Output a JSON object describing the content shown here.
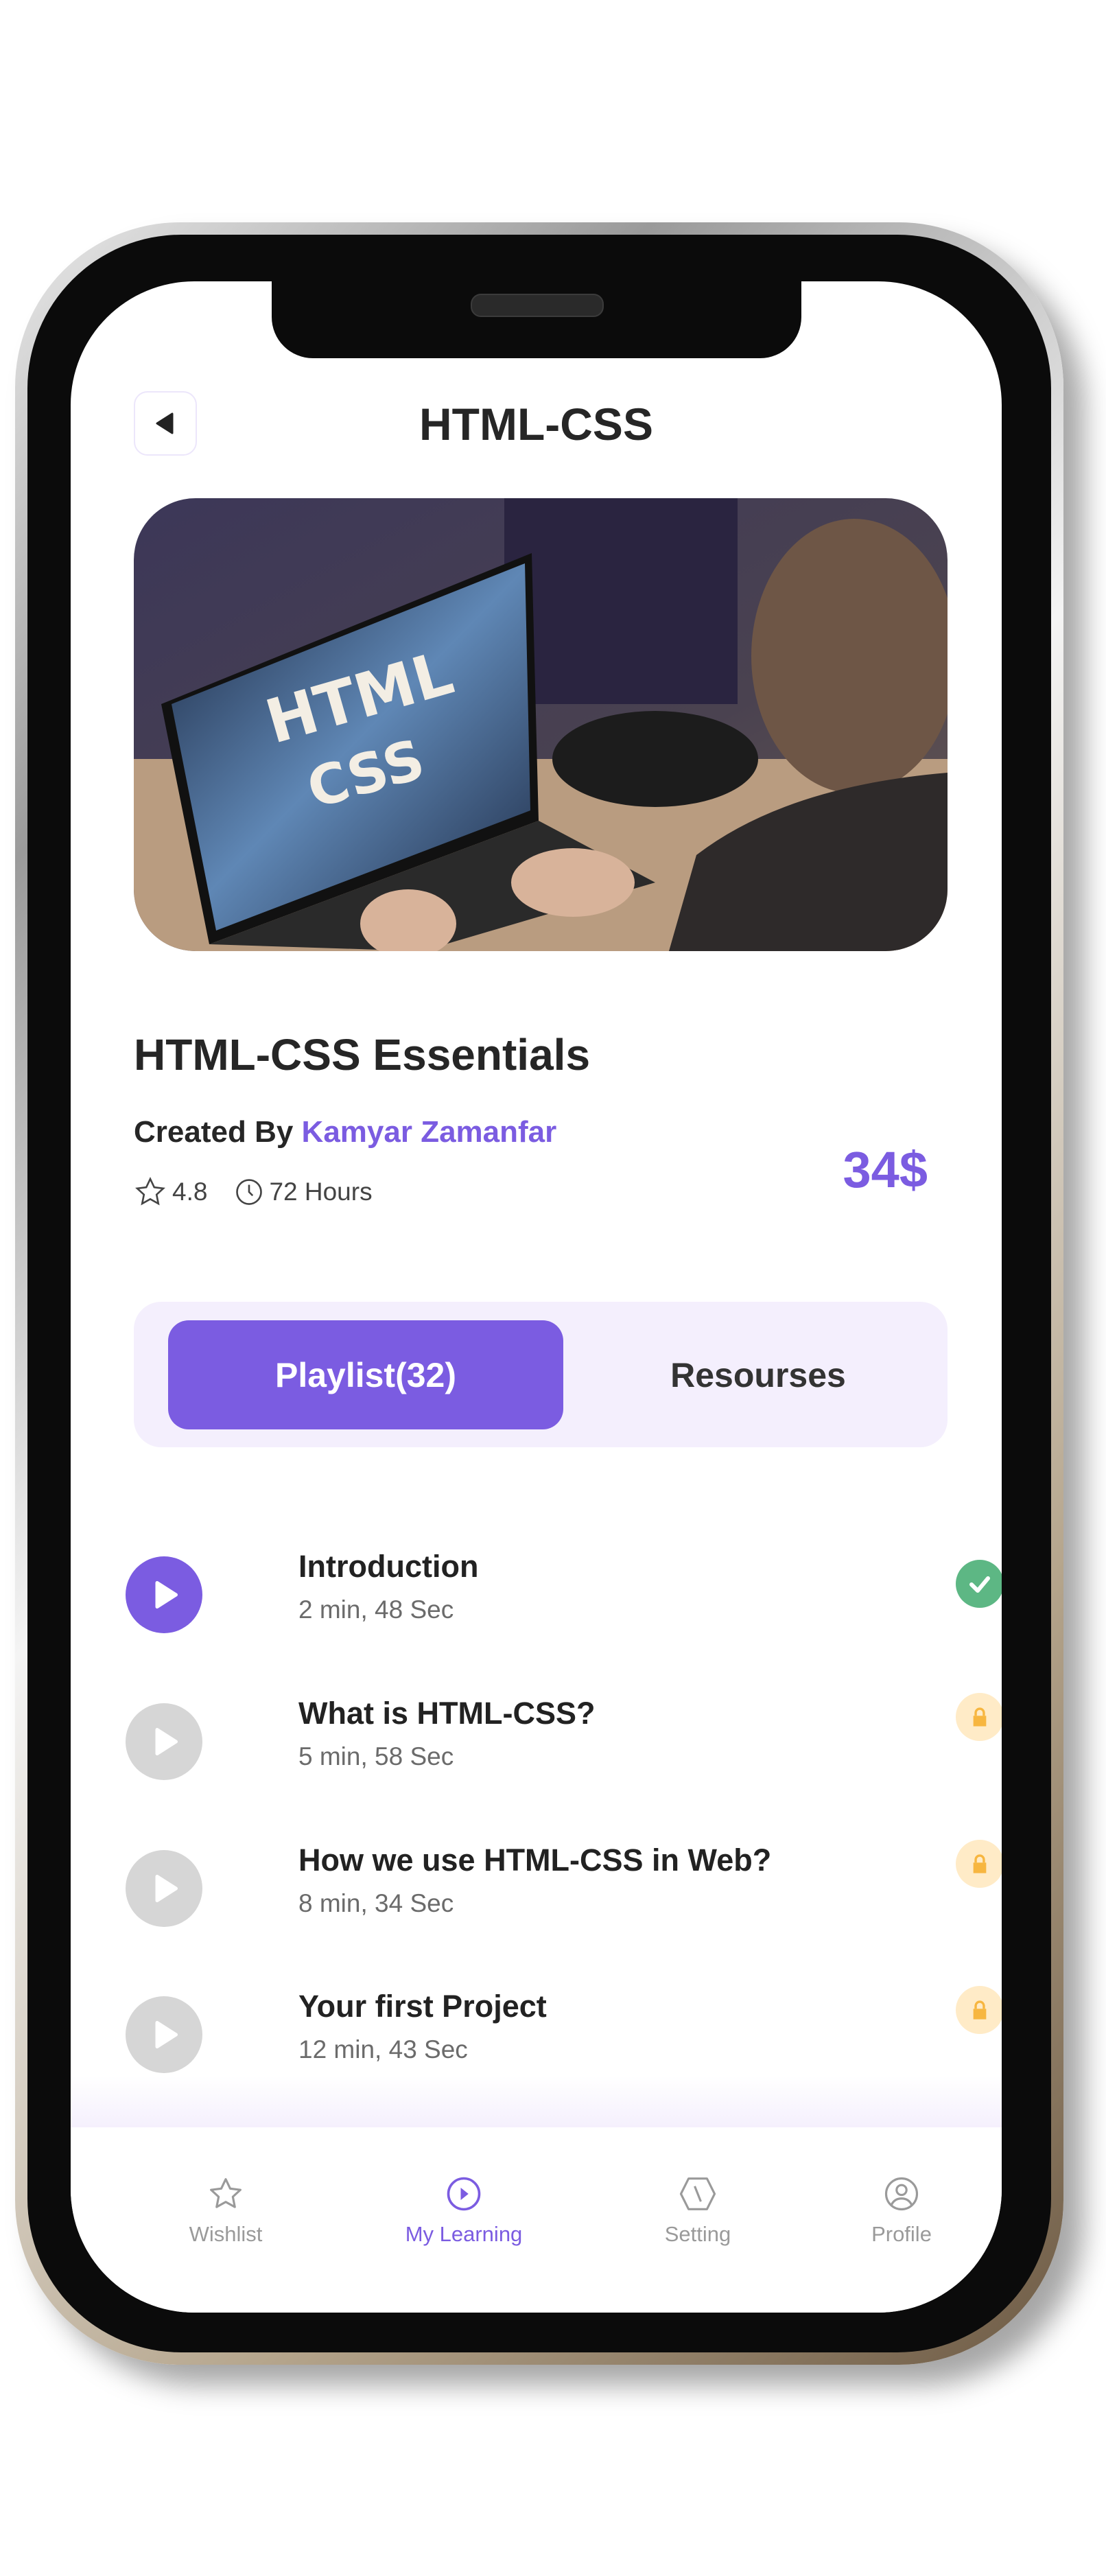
{
  "header": {
    "title": "HTML-CSS",
    "back_icon": "back-arrow-icon"
  },
  "hero_image": {
    "alt_lettering": [
      "HTML",
      "CSS"
    ]
  },
  "course": {
    "title": "HTML-CSS Essentials",
    "created_by_label": "Created By",
    "author": "Kamyar Zamanfar",
    "rating": "4.8",
    "duration": "72 Hours",
    "price": "34$"
  },
  "tabs": [
    {
      "label": "Playlist(32)",
      "active": true
    },
    {
      "label": "Resourses",
      "active": false
    }
  ],
  "playlist": [
    {
      "title": "Introduction",
      "duration": "2 min, 48 Sec",
      "status": "completed"
    },
    {
      "title": "What is HTML-CSS?",
      "duration": "5 min, 58 Sec",
      "status": "locked"
    },
    {
      "title": "How we use HTML-CSS in Web?",
      "duration": "8 min, 34 Sec",
      "status": "locked"
    },
    {
      "title": "Your first Project",
      "duration": "12 min, 43 Sec",
      "status": "locked"
    }
  ],
  "nav": [
    {
      "label": "Wishlist",
      "icon": "star-icon",
      "active": false
    },
    {
      "label": "My Learning",
      "icon": "play-circle-icon",
      "active": true
    },
    {
      "label": "Setting",
      "icon": "settings-hexagon-icon",
      "active": false
    },
    {
      "label": "Profile",
      "icon": "user-circle-icon",
      "active": false
    }
  ],
  "colors": {
    "accent": "#7B5CE1",
    "accent_light": "#F4EFFD",
    "success": "#5DB784",
    "locked_bg": "#FFEBC7",
    "locked": "#F7B640",
    "inactive_play": "#D6D6D6"
  }
}
